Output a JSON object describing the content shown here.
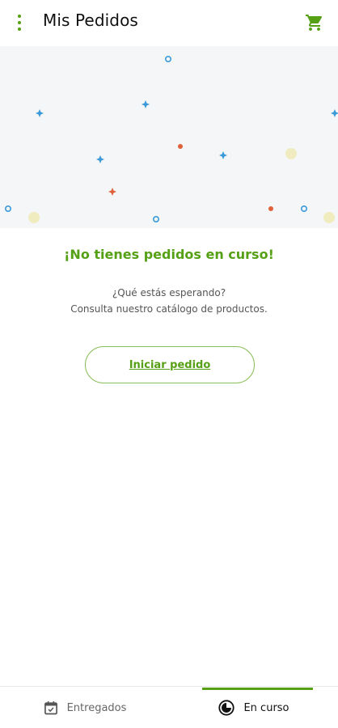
{
  "header": {
    "title": "Mis Pedidos",
    "menu_icon": "more-vert-icon",
    "cart_icon": "shopping-cart-icon"
  },
  "empty_state": {
    "title": "¡No tienes pedidos en curso!",
    "line1": "¿Qué estás esperando?",
    "line2": "Consulta nuestro catálogo de productos.",
    "button_label": "Iniciar pedido"
  },
  "bottom_nav": {
    "tabs": [
      {
        "label": "Entregados",
        "icon": "calendar-check-icon",
        "active": false
      },
      {
        "label": "En curso",
        "icon": "clock-progress-icon",
        "active": true
      }
    ]
  },
  "colors": {
    "accent": "#55a015",
    "hero_bg": "#f5f6f8",
    "confetti_blue": "#3a9ad9",
    "confetti_orange": "#e0603a",
    "confetti_yellow": "#f1ecc0"
  }
}
